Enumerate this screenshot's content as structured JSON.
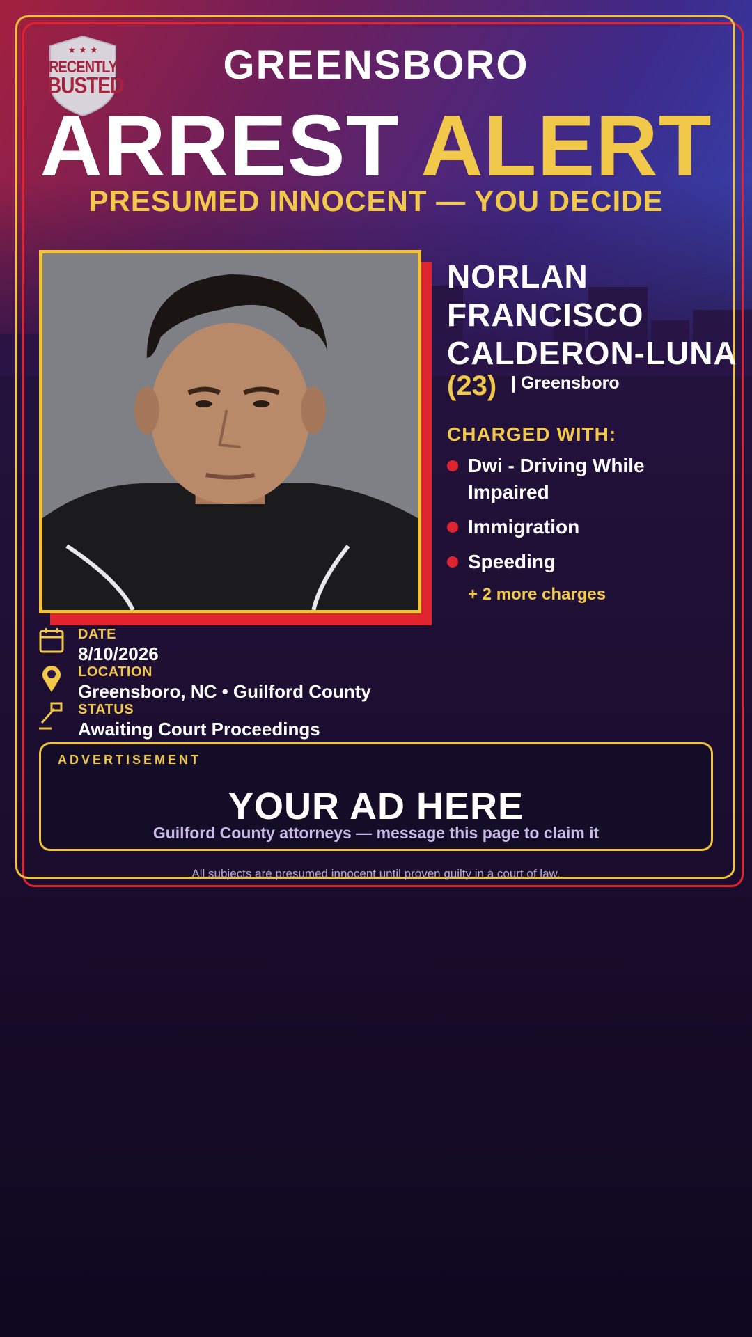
{
  "brand": {
    "logo_line1": "RECENTLY",
    "logo_line2": "BUSTED",
    "logo_stars": "★ ★ ★"
  },
  "header": {
    "city": "GREENSBORO",
    "headline_white": "ARREST",
    "headline_gold": "ALERT",
    "subhead": "PRESUMED INNOCENT — YOU DECIDE"
  },
  "subject": {
    "name_lines": [
      "NORLAN",
      "FRANCISCO",
      "CALDERON-LUNA"
    ],
    "age": "(23)",
    "hometown": "| Greensboro"
  },
  "charges": {
    "title": "CHARGED WITH:",
    "items": [
      "Dwi - Driving While Impaired",
      "Immigration",
      "Speeding"
    ],
    "more": "+ 2 more charges"
  },
  "details": {
    "date_label": "DATE",
    "date_value": "8/10/2026",
    "location_label": "LOCATION",
    "location_value": "Greensboro, NC • Guilford County",
    "status_label": "STATUS",
    "status_value": "Awaiting Court Proceedings"
  },
  "ad": {
    "tag": "ADVERTISEMENT",
    "title": "YOUR AD HERE",
    "subtitle": "Guilford County attorneys — message this page to claim it"
  },
  "footer": {
    "disclaimer": "All subjects are presumed innocent until proven guilty in a court of law."
  },
  "colors": {
    "gold": "#f2c84b",
    "red": "#e0242f",
    "bg_dark": "#1f1035"
  },
  "icons": [
    "calendar-icon",
    "location-pin-icon",
    "gavel-icon"
  ]
}
